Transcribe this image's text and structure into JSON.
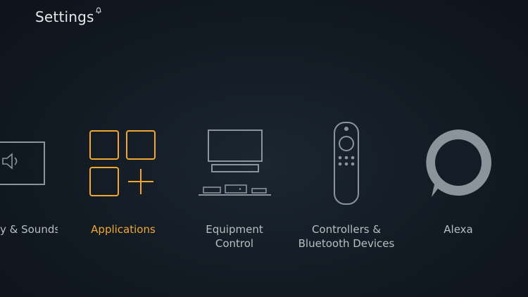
{
  "header": {
    "title": "Settings"
  },
  "tiles": [
    {
      "label": "Display & Sounds",
      "visible_label": "y & Sounds",
      "icon": "tv-speaker-icon",
      "selected": false
    },
    {
      "label": "Applications",
      "icon": "apps-grid-icon",
      "selected": true
    },
    {
      "label": "Equipment\nControl",
      "icon": "equipment-icon",
      "selected": false
    },
    {
      "label": "Controllers &\nBluetooth Devices",
      "icon": "remote-icon",
      "selected": false
    },
    {
      "label": "Alexa",
      "icon": "alexa-icon",
      "selected": false
    }
  ],
  "colors": {
    "accent": "#f0a832",
    "icon": "#8c949b",
    "text": "#b9bec3",
    "title": "#e6e8ea"
  }
}
